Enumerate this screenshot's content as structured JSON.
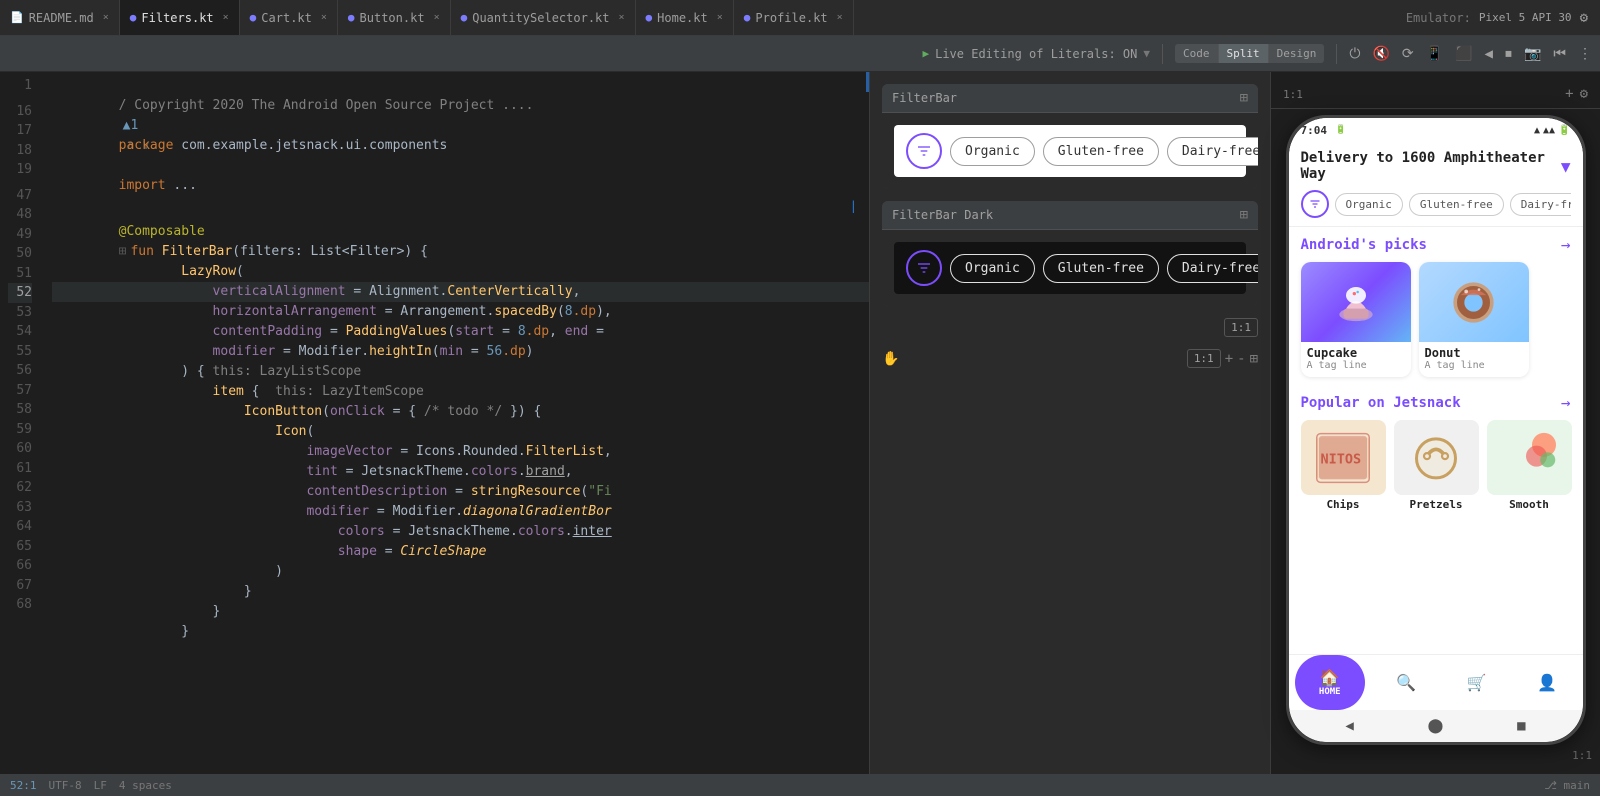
{
  "tabs": [
    {
      "label": "README.md",
      "icon": "📄",
      "active": false
    },
    {
      "label": "Filters.kt",
      "icon": "🔵",
      "active": true
    },
    {
      "label": "Cart.kt",
      "icon": "🔵",
      "active": false
    },
    {
      "label": "Button.kt",
      "icon": "🔵",
      "active": false
    },
    {
      "label": "QuantitySelector.kt",
      "icon": "🔵",
      "active": false
    },
    {
      "label": "Home.kt",
      "icon": "🔵",
      "active": false
    },
    {
      "label": "Profile.kt",
      "icon": "🔵",
      "active": false
    }
  ],
  "toolbar": {
    "live_editing": "Live Editing of Literals: ON",
    "code_label": "Code",
    "split_label": "Split",
    "design_label": "Design"
  },
  "emulator": {
    "label": "Emulator:",
    "device": "Pixel 5 API 30"
  },
  "code_lines": [
    {
      "num": "1",
      "content": "/ Copyright 2020 The Android Open Source Project ....",
      "highlight": false
    },
    {
      "num": "16",
      "content": "",
      "highlight": false
    },
    {
      "num": "17",
      "content": "",
      "highlight": false
    },
    {
      "num": "18",
      "content": "",
      "highlight": false
    },
    {
      "num": "19",
      "content": "",
      "highlight": false
    },
    {
      "num": "47",
      "content": "",
      "highlight": false
    },
    {
      "num": "48",
      "content": "",
      "highlight": false
    },
    {
      "num": "49",
      "content": "",
      "highlight": false
    },
    {
      "num": "50",
      "content": "",
      "highlight": false
    },
    {
      "num": "51",
      "content": "",
      "highlight": false
    },
    {
      "num": "52",
      "content": "",
      "highlight": true
    },
    {
      "num": "53",
      "content": "",
      "highlight": false
    },
    {
      "num": "54",
      "content": "",
      "highlight": false
    },
    {
      "num": "55",
      "content": "",
      "highlight": false
    },
    {
      "num": "56",
      "content": "",
      "highlight": false
    },
    {
      "num": "57",
      "content": "",
      "highlight": false
    },
    {
      "num": "58",
      "content": "",
      "highlight": false
    },
    {
      "num": "59",
      "content": "",
      "highlight": false
    },
    {
      "num": "60",
      "content": "",
      "highlight": false
    },
    {
      "num": "61",
      "content": "",
      "highlight": false
    },
    {
      "num": "62",
      "content": "",
      "highlight": false
    },
    {
      "num": "63",
      "content": "",
      "highlight": false
    },
    {
      "num": "64",
      "content": "",
      "highlight": false
    },
    {
      "num": "65",
      "content": "",
      "highlight": false
    },
    {
      "num": "66",
      "content": "",
      "highlight": false
    },
    {
      "num": "67",
      "content": "",
      "highlight": false
    },
    {
      "num": "68",
      "content": "",
      "highlight": false
    }
  ],
  "preview": {
    "filterbar_light_title": "FilterBar",
    "filterbar_dark_title": "FilterBar Dark",
    "chips_light": [
      "Organic",
      "Gluten-free",
      "Dairy-free"
    ],
    "chips_dark": [
      "Organic",
      "Gluten-free",
      "Dairy-free"
    ]
  },
  "phone": {
    "status_time": "7:04",
    "delivery_text": "Delivery to 1600 Amphitheater Way",
    "chips": [
      "Organic",
      "Gluten-free",
      "Dairy-free"
    ],
    "section1_title": "Android's picks",
    "picks": [
      {
        "name": "Cupcake",
        "tagline": "A tag line"
      },
      {
        "name": "Donut",
        "tagline": "A tag line"
      }
    ],
    "section2_title": "Popular on Jetsnack",
    "popular": [
      "Chips",
      "Pretzels",
      "Smooth"
    ],
    "nav": [
      "HOME",
      "",
      "",
      ""
    ],
    "bottom_nav": [
      "◀",
      "⬤",
      "■"
    ]
  }
}
